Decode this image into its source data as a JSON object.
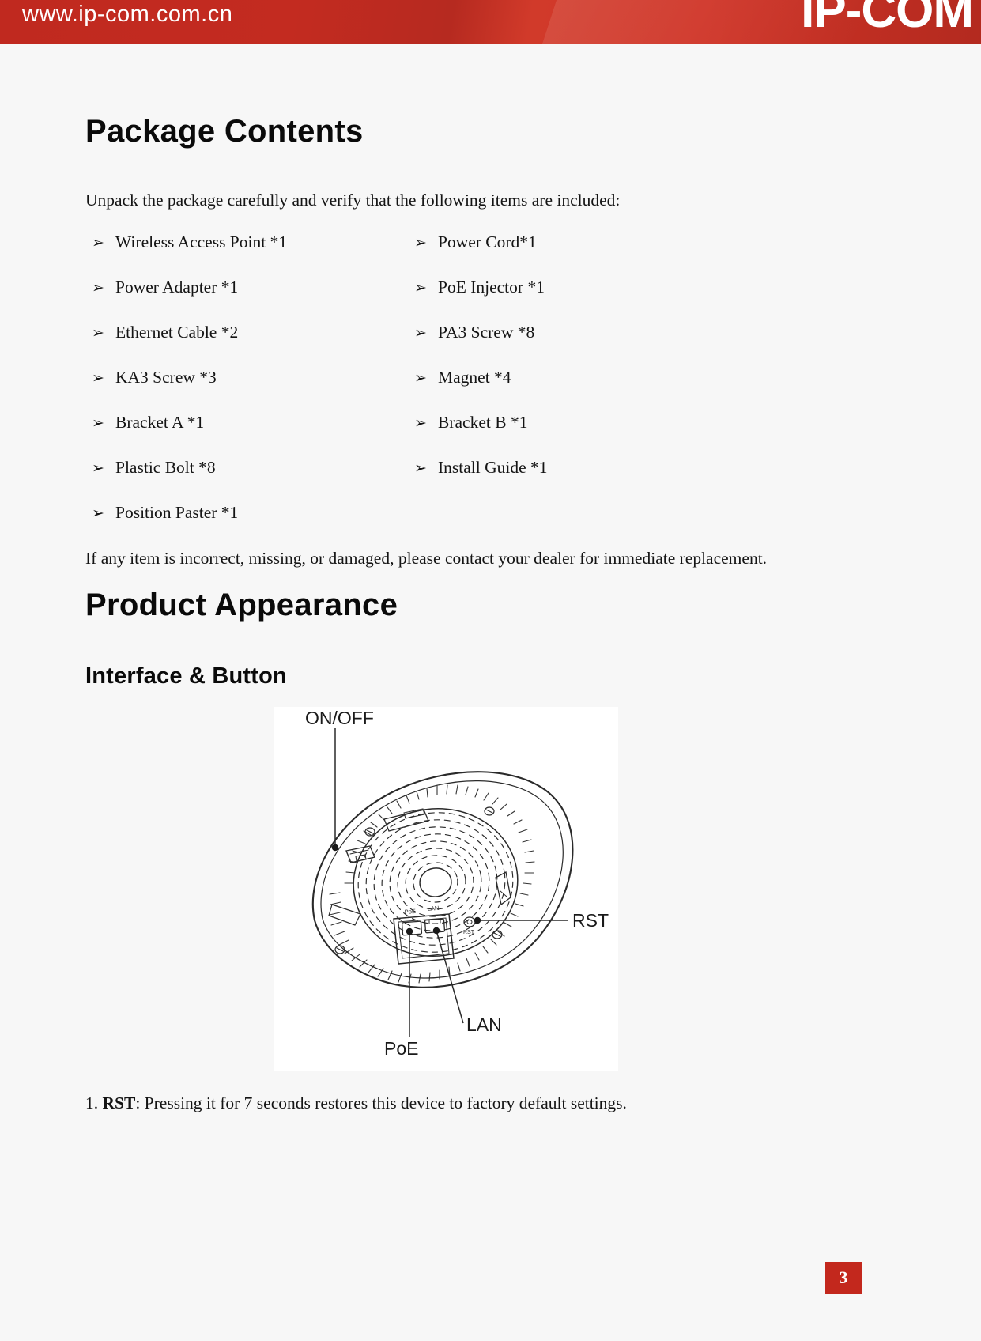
{
  "header": {
    "url": "www.ip-com.com.cn",
    "logo": "IP-COM",
    "background_color": "#c3281d"
  },
  "sections": {
    "package_contents_title": "Package Contents",
    "intro_paragraph": "Unpack the package carefully and verify that the following items are included:",
    "closing_paragraph": "If any item is incorrect, missing, or damaged, please contact your dealer for immediate replacement.",
    "product_appearance_title": "Product Appearance",
    "interface_button_title": "Interface & Button"
  },
  "package_items": {
    "bullet_marker": "➢",
    "left_column": [
      "Wireless Access Point *1",
      "Power Adapter *1",
      "Ethernet Cable *2",
      "KA3 Screw *3",
      "Bracket A *1",
      "Plastic Bolt *8",
      "Position Paster *1"
    ],
    "right_column": [
      "Power Cord*1",
      "PoE Injector *1",
      "PA3 Screw *8",
      "Magnet *4",
      "Bracket B *1",
      "Install Guide *1"
    ]
  },
  "figure": {
    "alt": "Line drawing of wireless access point underside with interface callouts",
    "callouts": {
      "on_off": "ON/OFF",
      "rst": "RST",
      "lan": "LAN",
      "poe": "PoE"
    },
    "device_labels": {
      "poe": "PoE",
      "lan": "LAN",
      "rst": "RST"
    }
  },
  "notes": [
    {
      "number": "1.",
      "key": "RST",
      "text": ": Pressing it for 7 seconds restores this device to factory default settings."
    }
  ],
  "footer": {
    "page_number": "3",
    "badge_color": "#c3281d"
  }
}
